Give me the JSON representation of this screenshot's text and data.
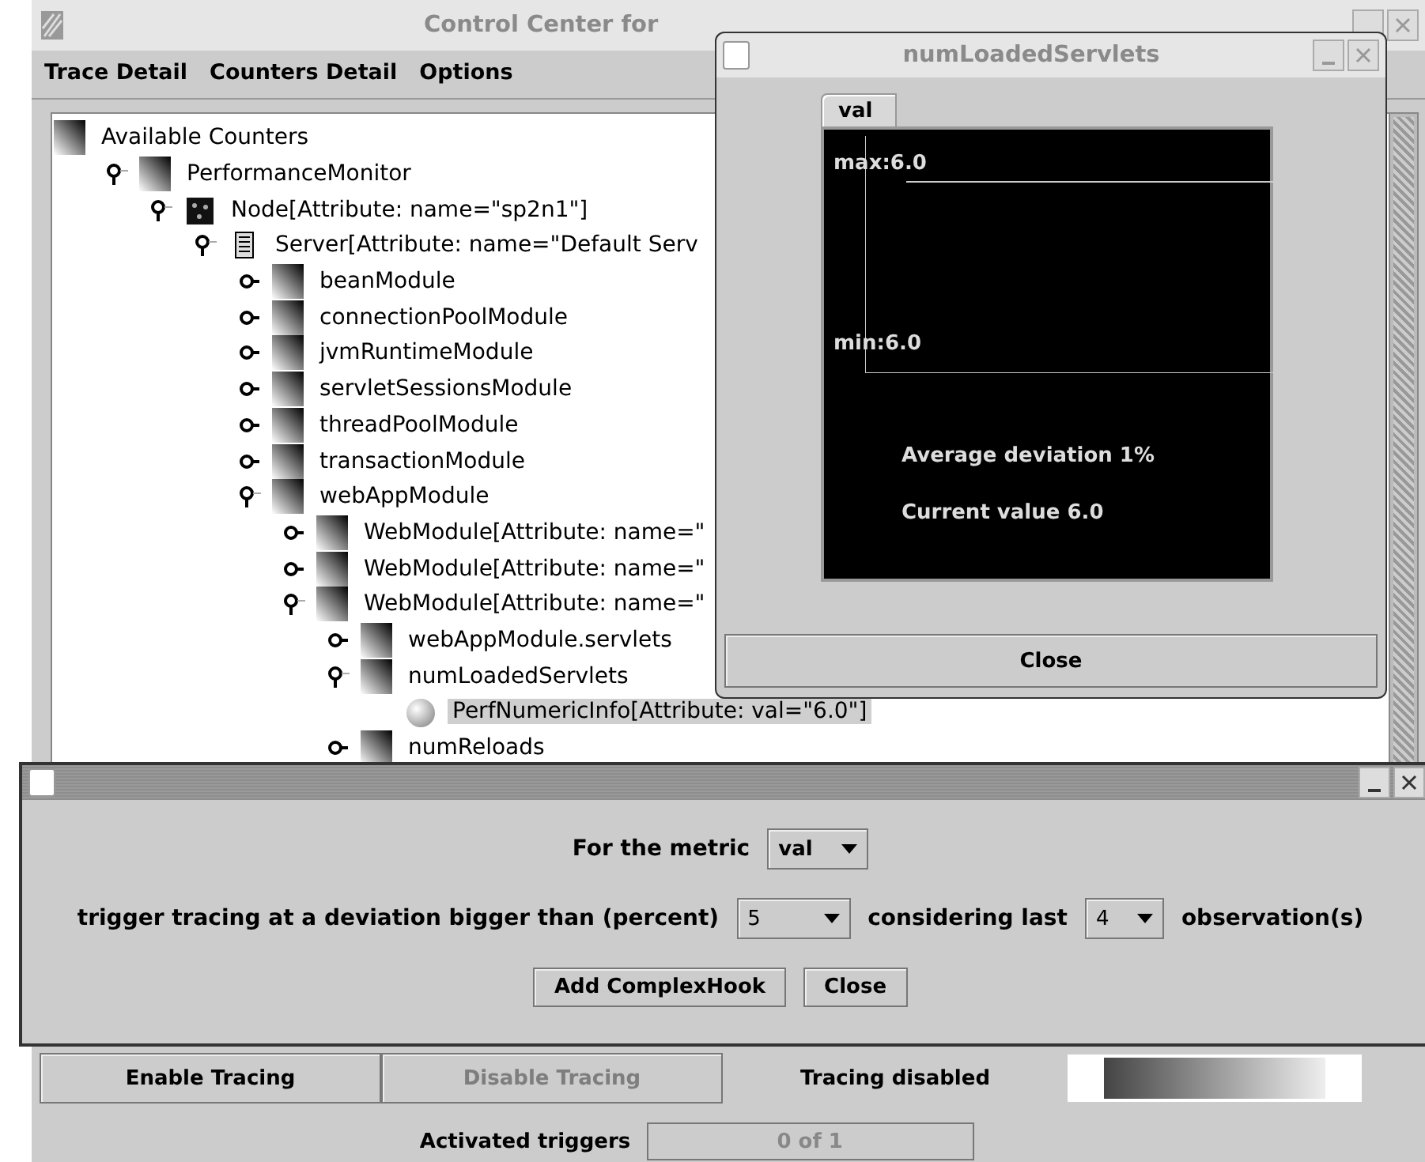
{
  "main_window": {
    "title": "Control Center for",
    "menu": [
      "Trace Detail",
      "Counters Detail",
      "Options"
    ],
    "tree": [
      {
        "label": "Available Counters",
        "kind": "folder",
        "selected": false,
        "children": [
          {
            "label": "PerformanceMonitor",
            "kind": "folder",
            "expanded": true,
            "selected": false,
            "children": [
              {
                "label": "Node[Attribute: name=\"sp2n1\"]",
                "kind": "node",
                "expanded": true,
                "selected": false,
                "children": [
                  {
                    "label": "Server[Attribute: name=\"Default Serv",
                    "kind": "server",
                    "expanded": true,
                    "selected": false,
                    "children": [
                      {
                        "label": "beanModule",
                        "kind": "folder",
                        "expanded": false,
                        "selected": false
                      },
                      {
                        "label": "connectionPoolModule",
                        "kind": "folder",
                        "expanded": false,
                        "selected": false
                      },
                      {
                        "label": "jvmRuntimeModule",
                        "kind": "folder",
                        "expanded": false,
                        "selected": false
                      },
                      {
                        "label": "servletSessionsModule",
                        "kind": "folder",
                        "expanded": false,
                        "selected": false
                      },
                      {
                        "label": "threadPoolModule",
                        "kind": "folder",
                        "expanded": false,
                        "selected": false
                      },
                      {
                        "label": "transactionModule",
                        "kind": "folder",
                        "expanded": false,
                        "selected": false
                      },
                      {
                        "label": "webAppModule",
                        "kind": "folder",
                        "expanded": true,
                        "selected": false,
                        "children": [
                          {
                            "label": "WebModule[Attribute: name=\"",
                            "kind": "folder",
                            "expanded": false,
                            "selected": false
                          },
                          {
                            "label": "WebModule[Attribute: name=\"",
                            "kind": "folder",
                            "expanded": false,
                            "selected": false
                          },
                          {
                            "label": "WebModule[Attribute: name=\"",
                            "kind": "folder",
                            "expanded": true,
                            "selected": false,
                            "children": [
                              {
                                "label": "webAppModule.servlets",
                                "kind": "folder",
                                "expanded": false,
                                "selected": false
                              },
                              {
                                "label": "numLoadedServlets",
                                "kind": "folder",
                                "expanded": true,
                                "selected": false,
                                "children": [
                                  {
                                    "label": "PerfNumericInfo[Attribute: val=\"6.0\"]",
                                    "kind": "leaf",
                                    "selected": true
                                  }
                                ]
                              },
                              {
                                "label": "numReloads",
                                "kind": "folder",
                                "expanded": false,
                                "selected": false
                              }
                            ]
                          }
                        ]
                      }
                    ]
                  }
                ]
              }
            ]
          }
        ]
      }
    ],
    "buttons": [
      {
        "label": "Enable Tracing",
        "disabled": false
      },
      {
        "label": "Disable Tracing",
        "disabled": true
      }
    ],
    "tracing_status": "Tracing disabled",
    "activated_triggers": {
      "label": "Activated triggers",
      "value": "0 of 1"
    }
  },
  "monitor_window": {
    "title": "numLoadedServlets",
    "tabs": [
      {
        "label": "val",
        "selected": true
      }
    ],
    "max_label": "max:6.0",
    "min_label": "min:6.0",
    "average_deviation": "Average deviation 1%",
    "current_value": "Current value 6.0",
    "close_button": "Close"
  },
  "hook_dialog": {
    "metric_label": "For the metric",
    "metric": "val",
    "deviation_label": "trigger tracing at a deviation bigger than (percent)",
    "deviation": "5",
    "considering_label": "considering last",
    "observations": "4",
    "observations_label": "observation(s)",
    "buttons": [
      "Add ComplexHook",
      "Close"
    ]
  }
}
